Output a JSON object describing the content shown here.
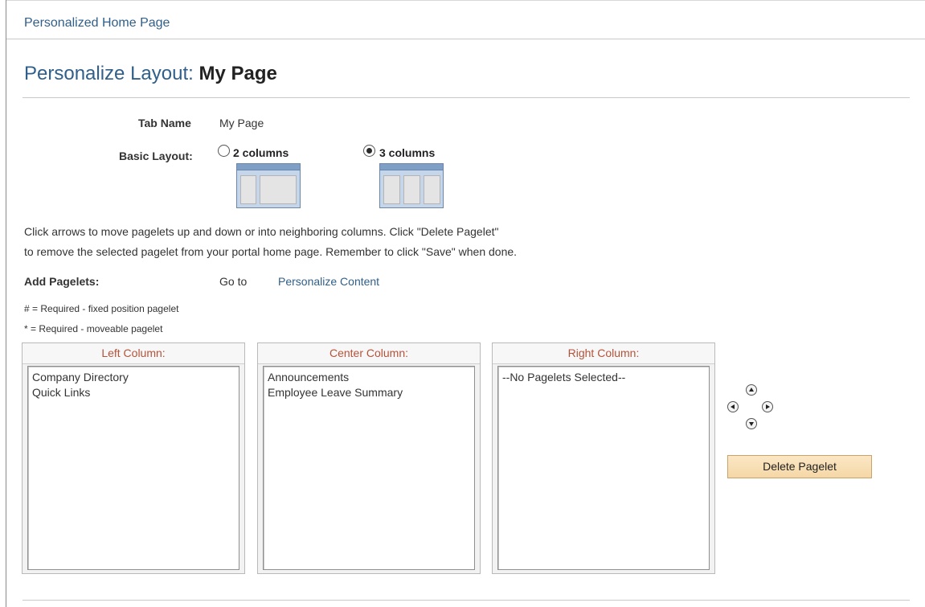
{
  "breadcrumb": "Personalized Home Page",
  "title": {
    "prefix": "Personalize Layout:",
    "name": "My Page"
  },
  "tab_name": {
    "label": "Tab Name",
    "value": "My Page"
  },
  "basic_layout": {
    "label": "Basic Layout:",
    "options": [
      {
        "label": "2 columns",
        "selected": false
      },
      {
        "label": "3 columns",
        "selected": true
      }
    ]
  },
  "instructions": {
    "line1": "Click arrows to move pagelets up and down or into neighboring columns. Click \"Delete Pagelet\"",
    "line2": "to remove the selected pagelet from your portal home page. Remember to click \"Save\" when done."
  },
  "add_pagelets": {
    "label": "Add Pagelets:",
    "goto": "Go to",
    "link": "Personalize Content"
  },
  "legend": {
    "fixed": "# = Required - fixed position pagelet",
    "moveable": "* = Required - moveable pagelet"
  },
  "columns": {
    "left": {
      "header": "Left Column:",
      "items": [
        "Company Directory",
        "Quick Links"
      ]
    },
    "center": {
      "header": "Center Column:",
      "items": [
        "Announcements",
        "Employee Leave Summary"
      ]
    },
    "right": {
      "header": "Right Column:",
      "items": [
        "--No Pagelets Selected--"
      ]
    }
  },
  "delete_button": "Delete Pagelet",
  "colors": {
    "link": "#2f5f8a",
    "column_header": "#b4533a",
    "button_bg": "#f5d7a6"
  },
  "icons": [
    "up-arrow-icon",
    "left-arrow-icon",
    "right-arrow-icon",
    "down-arrow-icon",
    "two-column-layout-icon",
    "three-column-layout-icon"
  ]
}
